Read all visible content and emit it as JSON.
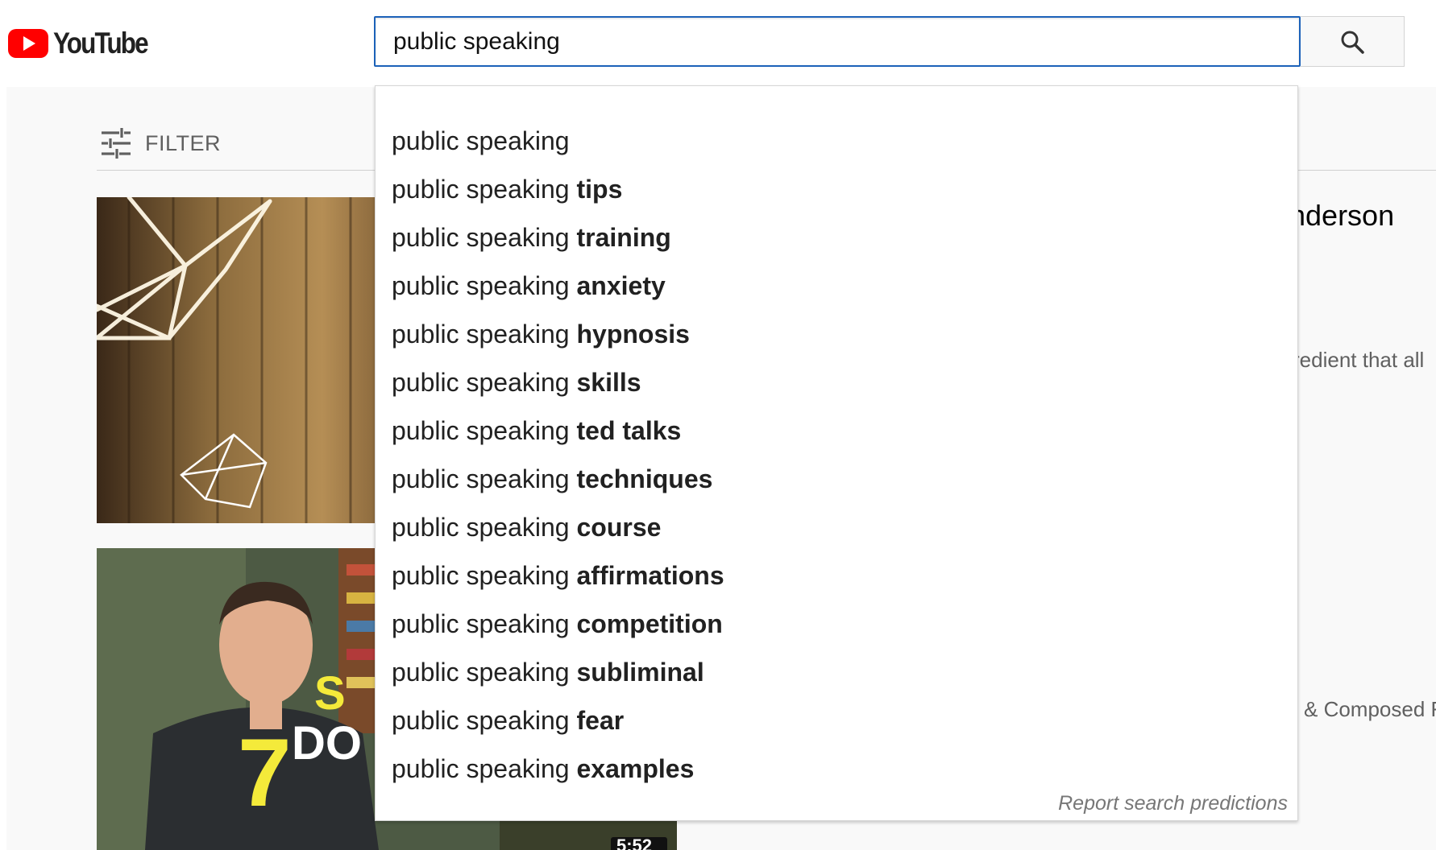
{
  "header": {
    "logo_text": "YouTube",
    "search": {
      "value": "public speaking",
      "button_icon": "search-icon"
    }
  },
  "colors": {
    "brand_red": "#ff0000",
    "focus_blue": "#1c62b9"
  },
  "page": {
    "filter_label": "FILTER",
    "filter_icon": "sliders-icon",
    "result_title_fragment": "nderson",
    "result_desc_fragment_1": "redient that all",
    "result_desc_fragment_2": "& Composed F",
    "thumbnail_2": {
      "overlay_number": "7",
      "overlay_text": "DO",
      "overlay_text_partial": "S",
      "duration_partial": "5:52"
    }
  },
  "suggestions": {
    "query": "public speaking",
    "items": [
      {
        "prefix": "public speaking",
        "completion": ""
      },
      {
        "prefix": "public speaking",
        "completion": "tips"
      },
      {
        "prefix": "public speaking",
        "completion": "training"
      },
      {
        "prefix": "public speaking",
        "completion": "anxiety"
      },
      {
        "prefix": "public speaking",
        "completion": "hypnosis"
      },
      {
        "prefix": "public speaking",
        "completion": "skills"
      },
      {
        "prefix": "public speaking",
        "completion": "ted talks"
      },
      {
        "prefix": "public speaking",
        "completion": "techniques"
      },
      {
        "prefix": "public speaking",
        "completion": "course"
      },
      {
        "prefix": "public speaking",
        "completion": "affirmations"
      },
      {
        "prefix": "public speaking",
        "completion": "competition"
      },
      {
        "prefix": "public speaking",
        "completion": "subliminal"
      },
      {
        "prefix": "public speaking",
        "completion": "fear"
      },
      {
        "prefix": "public speaking",
        "completion": "examples"
      }
    ],
    "report_link": "Report search predictions"
  }
}
